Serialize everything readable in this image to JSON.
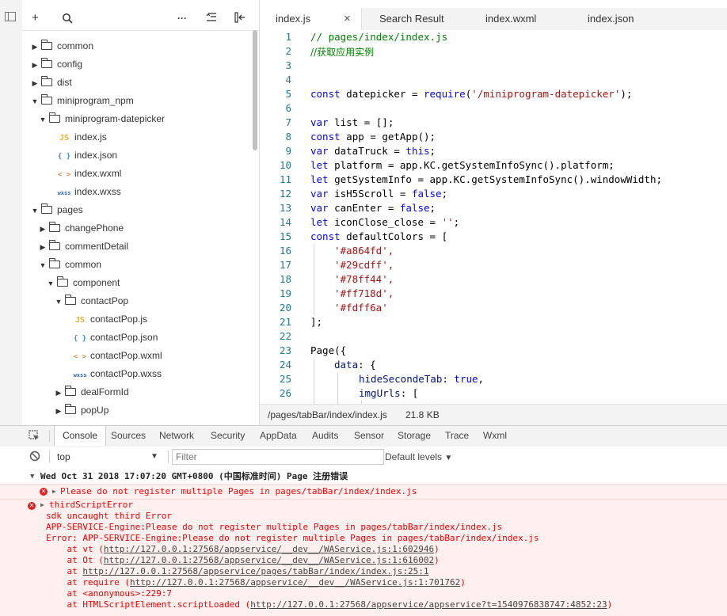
{
  "explorer": {
    "toolbar": {
      "add": "+",
      "search": "⚲",
      "more": "···"
    },
    "tree": [
      {
        "label": "common",
        "type": "folder",
        "open": false
      },
      {
        "label": "config",
        "type": "folder",
        "open": false
      },
      {
        "label": "dist",
        "type": "folder",
        "open": false
      },
      {
        "label": "miniprogram_npm",
        "type": "folder",
        "open": true
      },
      {
        "label": "miniprogram-datepicker",
        "type": "folder",
        "open": true
      },
      {
        "label": "index.js",
        "type": "js"
      },
      {
        "label": "index.json",
        "type": "json"
      },
      {
        "label": "index.wxml",
        "type": "wxml"
      },
      {
        "label": "index.wxss",
        "type": "wxss"
      },
      {
        "label": "pages",
        "type": "folder",
        "open": true
      },
      {
        "label": "changePhone",
        "type": "folder",
        "open": false
      },
      {
        "label": "commentDetail",
        "type": "folder",
        "open": false
      },
      {
        "label": "common",
        "type": "folder",
        "open": true
      },
      {
        "label": "component",
        "type": "folder",
        "open": true
      },
      {
        "label": "contactPop",
        "type": "folder",
        "open": true
      },
      {
        "label": "contactPop.js",
        "type": "js"
      },
      {
        "label": "contactPop.json",
        "type": "json"
      },
      {
        "label": "contactPop.wxml",
        "type": "wxml"
      },
      {
        "label": "contactPop.wxss",
        "type": "wxss"
      },
      {
        "label": "dealFormId",
        "type": "folder",
        "open": false
      },
      {
        "label": "popUp",
        "type": "folder",
        "open": false
      }
    ],
    "icons": {
      "js": "JS",
      "json": "{ }",
      "wxml": "< >",
      "wxss": "wxss"
    }
  },
  "editor": {
    "tabs": [
      {
        "label": "index.js",
        "close": "×"
      },
      {
        "label": "Search Result"
      },
      {
        "label": "index.wxml"
      },
      {
        "label": "index.json"
      }
    ],
    "lines": [
      {
        "n": "1",
        "t": "// pages/index/index.js"
      },
      {
        "n": "2",
        "t": "//获取应用实例"
      },
      {
        "n": "3",
        "t": ""
      },
      {
        "n": "4",
        "t": ""
      },
      {
        "n": "5",
        "t": "const datepicker = require('/miniprogram-datepicker');"
      },
      {
        "n": "6",
        "t": ""
      },
      {
        "n": "7",
        "t": "var list = [];"
      },
      {
        "n": "8",
        "t": "const app = getApp();"
      },
      {
        "n": "9",
        "t": "var dataTruck = this;"
      },
      {
        "n": "10",
        "t": "let platform = app.KC.getSystemInfoSync().platform;"
      },
      {
        "n": "11",
        "t": "let getSystemInfo = app.KC.getSystemInfoSync().windowWidth;"
      },
      {
        "n": "12",
        "t": "var isH5Scroll = false;"
      },
      {
        "n": "13",
        "t": "var canEnter = false;"
      },
      {
        "n": "14",
        "t": "let iconClose_close = '';"
      },
      {
        "n": "15",
        "t": "const defaultColors = ["
      },
      {
        "n": "16",
        "t": "'#a864fd',"
      },
      {
        "n": "17",
        "t": "'#29cdff',"
      },
      {
        "n": "18",
        "t": "'#78ff44',"
      },
      {
        "n": "19",
        "t": "'#ff718d',"
      },
      {
        "n": "20",
        "t": "'#fdff6a'"
      },
      {
        "n": "21",
        "t": "];"
      },
      {
        "n": "22",
        "t": ""
      },
      {
        "n": "23",
        "t": "Page({"
      },
      {
        "n": "24",
        "t": "data: {"
      },
      {
        "n": "25",
        "t": "hideSecondeTab: true,"
      },
      {
        "n": "26",
        "t": "imgUrls: ["
      }
    ],
    "status": {
      "path": "/pages/tabBar/index/index.js",
      "size": "21.8 KB"
    }
  },
  "console": {
    "tabs": [
      "Console",
      "Sources",
      "Network",
      "Security",
      "AppData",
      "Audits",
      "Sensor",
      "Storage",
      "Trace",
      "Wxml"
    ],
    "context": "top",
    "filter_placeholder": "Filter",
    "levels": "Default levels",
    "group_header": "Wed Oct 31 2018 17:07:20 GMT+0800 (中国标准时间) Page 注册错误",
    "error1": "Please do not register multiple Pages in pages/tabBar/index/index.js",
    "error2_title": "thirdScriptError",
    "error2_lines": [
      "sdk uncaught third Error",
      "APP-SERVICE-Engine:Please do not register multiple Pages in pages/tabBar/index/index.js",
      "Error: APP-SERVICE-Engine:Please do not register multiple Pages in pages/tabBar/index/index.js"
    ],
    "stack": [
      {
        "pre": "    at vt (",
        "link": "http://127.0.0.1:27568/appservice/__dev__/WAService.js:1:602946",
        "post": ")"
      },
      {
        "pre": "    at Ot (",
        "link": "http://127.0.0.1:27568/appservice/__dev__/WAService.js:1:616002",
        "post": ")"
      },
      {
        "pre": "    at ",
        "link": "http://127.0.0.1:27568/appservice/pages/tabBar/index/index.js:25:1",
        "post": ""
      },
      {
        "pre": "    at require (",
        "link": "http://127.0.0.1:27568/appservice/__dev__/WAService.js:1:701762",
        "post": ")"
      },
      {
        "pre": "    at <anonymous>:229:7",
        "link": "",
        "post": ""
      },
      {
        "pre": "    at HTMLScriptElement.scriptLoaded (",
        "link": "http://127.0.0.1:27568/appservice/appservice?t=1540976838747:4852:23",
        "post": ")"
      }
    ]
  }
}
